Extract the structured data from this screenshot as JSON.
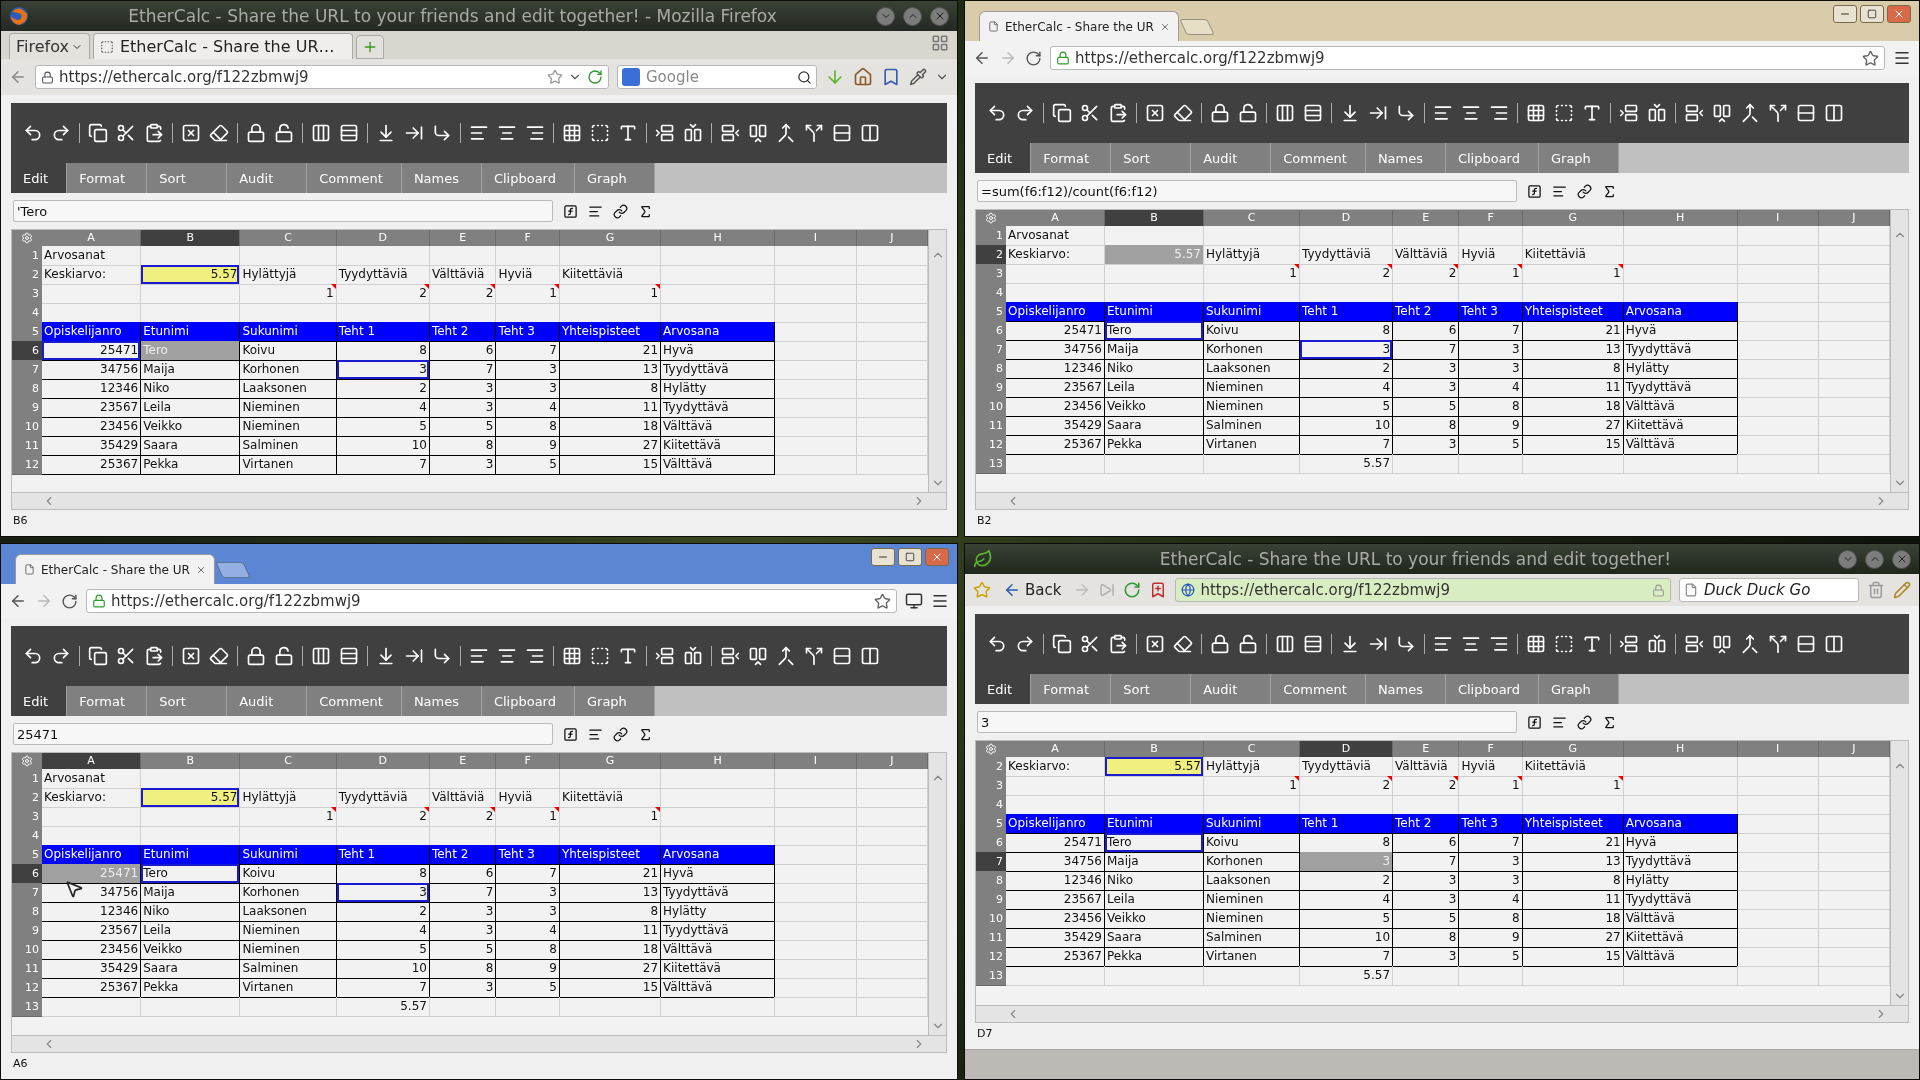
{
  "windows": [
    {
      "kind": "firefox",
      "color": "#232823",
      "title": "EtherCalc - Share the URL to your friends and edit together! - Mozilla Firefox",
      "menu_button": "Firefox",
      "tab_title": "EtherCalc - Share the UR…",
      "url": "https://ethercalc.org/f122zbmwj9",
      "search_placeholder": "Google",
      "app": {
        "tabs": [
          {
            "label": "Edit",
            "selected": true
          },
          {
            "label": "Format",
            "selected": false
          },
          {
            "label": "Sort",
            "selected": false
          },
          {
            "label": "Audit",
            "selected": false
          },
          {
            "label": "Comment",
            "selected": false
          },
          {
            "label": "Names",
            "selected": false
          },
          {
            "label": "Clipboard",
            "selected": false
          },
          {
            "label": "Graph",
            "selected": false
          }
        ],
        "formula": "'Tero",
        "columns": [
          {
            "label": "A",
            "selected": false,
            "kind": "number"
          },
          {
            "label": "B",
            "selected": true,
            "kind": "text"
          },
          {
            "label": "C",
            "selected": false,
            "kind": "text"
          },
          {
            "label": "D",
            "selected": false,
            "kind": "number"
          },
          {
            "label": "E",
            "selected": false,
            "kind": "number"
          },
          {
            "label": "F",
            "selected": false,
            "kind": "number"
          },
          {
            "label": "G",
            "selected": false,
            "kind": "number"
          },
          {
            "label": "H",
            "selected": false,
            "kind": "text"
          },
          {
            "label": "I",
            "selected": false,
            "kind": "blank"
          },
          {
            "label": "J",
            "selected": false,
            "kind": "blank"
          }
        ],
        "rows": [
          {
            "number": "1",
            "selected": false,
            "kind": "labels",
            "cells": [
              "Arvosanat"
            ]
          },
          {
            "number": "2",
            "selected": false,
            "kind": "labels",
            "cells": [
              "Keskiarvo:",
              {
                "text": "5.57",
                "kind": "right",
                "selected": false,
                "peer": true,
                "highlighted": true
              },
              "Hylättyjä",
              "Tyydyttäviä",
              "Välttäviä",
              "Hyviä",
              "Kiitettäviä"
            ]
          },
          {
            "number": "3",
            "selected": false,
            "kind": "counts",
            "cells": [
              null,
              null,
              {
                "text": "1",
                "comment": true
              },
              {
                "text": "2",
                "comment": true
              },
              {
                "text": "2",
                "comment": true
              },
              {
                "text": "1",
                "comment": true
              },
              {
                "text": "1",
                "comment": true
              }
            ]
          },
          {
            "number": "4",
            "selected": false,
            "kind": "blank"
          },
          {
            "number": "5",
            "selected": false,
            "kind": "header",
            "cells": [
              "Opiskelijanro",
              "Etunimi",
              "Sukunimi",
              "Teht 1",
              "Teht 2",
              "Teht 3",
              "Yhteispisteet",
              "Arvosana"
            ]
          },
          {
            "number": "6",
            "selected": true,
            "kind": "record",
            "cells": [
              {
                "text": "25471",
                "selected": false,
                "peer": true
              },
              {
                "text": "Tero",
                "selected": true,
                "peer": false
              },
              "Koivu",
              "8",
              "6",
              "7",
              "21",
              "Hyvä"
            ]
          },
          {
            "number": "7",
            "selected": false,
            "kind": "record",
            "cells": [
              "34756",
              "Maija",
              "Korhonen",
              {
                "text": "3",
                "selected": false,
                "peer": true
              },
              "7",
              "3",
              "13",
              "Tyydyttävä"
            ]
          },
          {
            "number": "8",
            "selected": false,
            "kind": "record",
            "cells": [
              "12346",
              "Niko",
              "Laaksonen",
              "2",
              "3",
              "3",
              "8",
              "Hylätty"
            ]
          },
          {
            "number": "9",
            "selected": false,
            "kind": "record",
            "cells": [
              "23567",
              "Leila",
              "Nieminen",
              "4",
              "3",
              "4",
              "11",
              "Tyydyttävä"
            ]
          },
          {
            "number": "10",
            "selected": false,
            "kind": "record",
            "cells": [
              "23456",
              "Veikko",
              "Nieminen",
              "5",
              "5",
              "8",
              "18",
              "Välttävä"
            ]
          },
          {
            "number": "11",
            "selected": false,
            "kind": "record",
            "cells": [
              "35429",
              "Saara",
              "Salminen",
              "10",
              "8",
              "9",
              "27",
              "Kiitettävä"
            ]
          },
          {
            "number": "12",
            "selected": false,
            "kind": "record",
            "cells": [
              "25367",
              "Pekka",
              "Virtanen",
              "7",
              "3",
              "5",
              "15",
              "Välttävä"
            ]
          }
        ],
        "status": "B6"
      }
    },
    {
      "kind": "chrome",
      "color": "#d9ccaa",
      "tab_title": "EtherCalc - Share the UR",
      "url": "https://ethercalc.org/f122zbmwj9",
      "cast_button": false,
      "app": {
        "tabs": [
          {
            "label": "Edit",
            "selected": true
          },
          {
            "label": "Format",
            "selected": false
          },
          {
            "label": "Sort",
            "selected": false
          },
          {
            "label": "Audit",
            "selected": false
          },
          {
            "label": "Comment",
            "selected": false
          },
          {
            "label": "Names",
            "selected": false
          },
          {
            "label": "Clipboard",
            "selected": false
          },
          {
            "label": "Graph",
            "selected": false
          }
        ],
        "formula": "=sum(f6:f12)/count(f6:f12)",
        "columns": [
          {
            "label": "A",
            "selected": false,
            "kind": "number"
          },
          {
            "label": "B",
            "selected": true,
            "kind": "text"
          },
          {
            "label": "C",
            "selected": false,
            "kind": "text"
          },
          {
            "label": "D",
            "selected": false,
            "kind": "number"
          },
          {
            "label": "E",
            "selected": false,
            "kind": "number"
          },
          {
            "label": "F",
            "selected": false,
            "kind": "number"
          },
          {
            "label": "G",
            "selected": false,
            "kind": "number"
          },
          {
            "label": "H",
            "selected": false,
            "kind": "text"
          },
          {
            "label": "I",
            "selected": false,
            "kind": "blank"
          },
          {
            "label": "J",
            "selected": false,
            "kind": "blank"
          }
        ],
        "rows": [
          {
            "number": "1",
            "selected": false,
            "kind": "labels",
            "cells": [
              "Arvosanat"
            ]
          },
          {
            "number": "2",
            "selected": true,
            "kind": "labels",
            "cells": [
              "Keskiarvo:",
              {
                "text": "5.57",
                "kind": "right",
                "selected": true,
                "peer": false
              },
              "Hylättyjä",
              "Tyydyttäviä",
              "Välttäviä",
              "Hyviä",
              "Kiitettäviä"
            ]
          },
          {
            "number": "3",
            "selected": false,
            "kind": "counts",
            "cells": [
              null,
              null,
              {
                "text": "1",
                "comment": true
              },
              {
                "text": "2",
                "comment": true
              },
              {
                "text": "2",
                "comment": true
              },
              {
                "text": "1",
                "comment": true
              },
              {
                "text": "1",
                "comment": true
              }
            ]
          },
          {
            "number": "4",
            "selected": false,
            "kind": "blank"
          },
          {
            "number": "5",
            "selected": false,
            "kind": "header",
            "cells": [
              "Opiskelijanro",
              "Etunimi",
              "Sukunimi",
              "Teht 1",
              "Teht 2",
              "Teht 3",
              "Yhteispisteet",
              "Arvosana"
            ]
          },
          {
            "number": "6",
            "selected": false,
            "kind": "record",
            "cells": [
              "25471",
              {
                "text": "Tero",
                "selected": false,
                "peer": true
              },
              "Koivu",
              "8",
              "6",
              "7",
              "21",
              "Hyvä"
            ]
          },
          {
            "number": "7",
            "selected": false,
            "kind": "record",
            "cells": [
              "34756",
              "Maija",
              "Korhonen",
              {
                "text": "3",
                "selected": false,
                "peer": true
              },
              "7",
              "3",
              "13",
              "Tyydyttävä"
            ]
          },
          {
            "number": "8",
            "selected": false,
            "kind": "record",
            "cells": [
              "12346",
              "Niko",
              "Laaksonen",
              "2",
              "3",
              "3",
              "8",
              "Hylätty"
            ]
          },
          {
            "number": "9",
            "selected": false,
            "kind": "record",
            "cells": [
              "23567",
              "Leila",
              "Nieminen",
              "4",
              "3",
              "4",
              "11",
              "Tyydyttävä"
            ]
          },
          {
            "number": "10",
            "selected": false,
            "kind": "record",
            "cells": [
              "23456",
              "Veikko",
              "Nieminen",
              "5",
              "5",
              "8",
              "18",
              "Välttävä"
            ]
          },
          {
            "number": "11",
            "selected": false,
            "kind": "record",
            "cells": [
              "35429",
              "Saara",
              "Salminen",
              "10",
              "8",
              "9",
              "27",
              "Kiitettävä"
            ]
          },
          {
            "number": "12",
            "selected": false,
            "kind": "record",
            "cells": [
              "25367",
              "Pekka",
              "Virtanen",
              "7",
              "3",
              "5",
              "15",
              "Välttävä"
            ]
          },
          {
            "number": "13",
            "selected": false,
            "kind": "total",
            "cells": [
              null,
              null,
              null,
              "5.57"
            ]
          }
        ],
        "status": "B2"
      }
    },
    {
      "kind": "chrome",
      "color": "#5b86d4",
      "tab_title": "EtherCalc - Share the UR",
      "url": "https://ethercalc.org/f122zbmwj9",
      "cast_button": true,
      "mouse_pointer": true,
      "app": {
        "tabs": [
          {
            "label": "Edit",
            "selected": true
          },
          {
            "label": "Format",
            "selected": false
          },
          {
            "label": "Sort",
            "selected": false
          },
          {
            "label": "Audit",
            "selected": false
          },
          {
            "label": "Comment",
            "selected": false
          },
          {
            "label": "Names",
            "selected": false
          },
          {
            "label": "Clipboard",
            "selected": false
          },
          {
            "label": "Graph",
            "selected": false
          }
        ],
        "formula": "25471",
        "columns": [
          {
            "label": "A",
            "selected": true,
            "kind": "number"
          },
          {
            "label": "B",
            "selected": false,
            "kind": "text"
          },
          {
            "label": "C",
            "selected": false,
            "kind": "text"
          },
          {
            "label": "D",
            "selected": false,
            "kind": "number"
          },
          {
            "label": "E",
            "selected": false,
            "kind": "number"
          },
          {
            "label": "F",
            "selected": false,
            "kind": "number"
          },
          {
            "label": "G",
            "selected": false,
            "kind": "number"
          },
          {
            "label": "H",
            "selected": false,
            "kind": "text"
          },
          {
            "label": "I",
            "selected": false,
            "kind": "blank"
          },
          {
            "label": "J",
            "selected": false,
            "kind": "blank"
          }
        ],
        "rows": [
          {
            "number": "1",
            "selected": false,
            "kind": "labels",
            "cells": [
              "Arvosanat"
            ]
          },
          {
            "number": "2",
            "selected": false,
            "kind": "labels",
            "cells": [
              "Keskiarvo:",
              {
                "text": "5.57",
                "kind": "right",
                "selected": false,
                "peer": true,
                "highlighted": true
              },
              "Hylättyjä",
              "Tyydyttäviä",
              "Välttäviä",
              "Hyviä",
              "Kiitettäviä"
            ]
          },
          {
            "number": "3",
            "selected": false,
            "kind": "counts",
            "cells": [
              null,
              null,
              {
                "text": "1",
                "comment": true
              },
              {
                "text": "2",
                "comment": true
              },
              {
                "text": "2",
                "comment": true
              },
              {
                "text": "1",
                "comment": true
              },
              {
                "text": "1",
                "comment": true
              }
            ]
          },
          {
            "number": "4",
            "selected": false,
            "kind": "blank"
          },
          {
            "number": "5",
            "selected": false,
            "kind": "header",
            "cells": [
              "Opiskelijanro",
              "Etunimi",
              "Sukunimi",
              "Teht 1",
              "Teht 2",
              "Teht 3",
              "Yhteispisteet",
              "Arvosana"
            ]
          },
          {
            "number": "6",
            "selected": true,
            "kind": "record",
            "cells": [
              {
                "text": "25471",
                "selected": true,
                "peer": false
              },
              {
                "text": "Tero",
                "selected": false,
                "peer": true
              },
              "Koivu",
              "8",
              "6",
              "7",
              "21",
              "Hyvä"
            ]
          },
          {
            "number": "7",
            "selected": false,
            "kind": "record",
            "cells": [
              "34756",
              "Maija",
              "Korhonen",
              {
                "text": "3",
                "selected": false,
                "peer": true
              },
              "7",
              "3",
              "13",
              "Tyydyttävä"
            ]
          },
          {
            "number": "8",
            "selected": false,
            "kind": "record",
            "cells": [
              "12346",
              "Niko",
              "Laaksonen",
              "2",
              "3",
              "3",
              "8",
              "Hylätty"
            ]
          },
          {
            "number": "9",
            "selected": false,
            "kind": "record",
            "cells": [
              "23567",
              "Leila",
              "Nieminen",
              "4",
              "3",
              "4",
              "11",
              "Tyydyttävä"
            ]
          },
          {
            "number": "10",
            "selected": false,
            "kind": "record",
            "cells": [
              "23456",
              "Veikko",
              "Nieminen",
              "5",
              "5",
              "8",
              "18",
              "Välttävä"
            ]
          },
          {
            "number": "11",
            "selected": false,
            "kind": "record",
            "cells": [
              "35429",
              "Saara",
              "Salminen",
              "10",
              "8",
              "9",
              "27",
              "Kiitettävä"
            ]
          },
          {
            "number": "12",
            "selected": false,
            "kind": "record",
            "cells": [
              "25367",
              "Pekka",
              "Virtanen",
              "7",
              "3",
              "5",
              "15",
              "Välttävä"
            ]
          },
          {
            "number": "13",
            "selected": false,
            "kind": "total",
            "cells": [
              null,
              null,
              null,
              "5.57"
            ]
          }
        ],
        "status": "A6"
      }
    },
    {
      "kind": "other",
      "color": "#1f261c",
      "title": "EtherCalc - Share the URL to your friends and edit together!",
      "back_button": "Back",
      "url": "https://ethercalc.org/f122zbmwj9",
      "search_placeholder": "Duck Duck Go",
      "app": {
        "tabs": [
          {
            "label": "Edit",
            "selected": true
          },
          {
            "label": "Format",
            "selected": false
          },
          {
            "label": "Sort",
            "selected": false
          },
          {
            "label": "Audit",
            "selected": false
          },
          {
            "label": "Comment",
            "selected": false
          },
          {
            "label": "Names",
            "selected": false
          },
          {
            "label": "Clipboard",
            "selected": false
          },
          {
            "label": "Graph",
            "selected": false
          }
        ],
        "formula": "3",
        "columns": [
          {
            "label": "A",
            "selected": false,
            "kind": "number"
          },
          {
            "label": "B",
            "selected": false,
            "kind": "text"
          },
          {
            "label": "C",
            "selected": false,
            "kind": "text"
          },
          {
            "label": "D",
            "selected": true,
            "kind": "number"
          },
          {
            "label": "E",
            "selected": false,
            "kind": "number"
          },
          {
            "label": "F",
            "selected": false,
            "kind": "number"
          },
          {
            "label": "G",
            "selected": false,
            "kind": "number"
          },
          {
            "label": "H",
            "selected": false,
            "kind": "text"
          },
          {
            "label": "I",
            "selected": false,
            "kind": "blank"
          },
          {
            "label": "J",
            "selected": false,
            "kind": "blank"
          }
        ],
        "rows": [
          {
            "number": "2",
            "selected": false,
            "kind": "labels",
            "cells": [
              "Keskiarvo:",
              {
                "text": "5.57",
                "kind": "right",
                "selected": false,
                "peer": true,
                "highlighted": true
              },
              "Hylättyjä",
              "Tyydyttäviä",
              "Välttäviä",
              "Hyviä",
              "Kiitettäviä"
            ]
          },
          {
            "number": "3",
            "selected": false,
            "kind": "counts",
            "cells": [
              null,
              null,
              {
                "text": "1",
                "comment": true
              },
              {
                "text": "2",
                "comment": true
              },
              {
                "text": "2",
                "comment": true
              },
              {
                "text": "1",
                "comment": true
              },
              {
                "text": "1",
                "comment": true
              }
            ]
          },
          {
            "number": "4",
            "selected": false,
            "kind": "blank"
          },
          {
            "number": "5",
            "selected": false,
            "kind": "header",
            "cells": [
              "Opiskelijanro",
              "Etunimi",
              "Sukunimi",
              "Teht 1",
              "Teht 2",
              "Teht 3",
              "Yhteispisteet",
              "Arvosana"
            ]
          },
          {
            "number": "6",
            "selected": false,
            "kind": "record",
            "cells": [
              "25471",
              {
                "text": "Tero",
                "selected": false,
                "peer": true
              },
              "Koivu",
              "8",
              "6",
              "7",
              "21",
              "Hyvä"
            ]
          },
          {
            "number": "7",
            "selected": true,
            "kind": "record",
            "cells": [
              "34756",
              "Maija",
              "Korhonen",
              {
                "text": "3",
                "selected": true,
                "peer": false
              },
              "7",
              "3",
              "13",
              "Tyydyttävä"
            ]
          },
          {
            "number": "8",
            "selected": false,
            "kind": "record",
            "cells": [
              "12346",
              "Niko",
              "Laaksonen",
              "2",
              "3",
              "3",
              "8",
              "Hylätty"
            ]
          },
          {
            "number": "9",
            "selected": false,
            "kind": "record",
            "cells": [
              "23567",
              "Leila",
              "Nieminen",
              "4",
              "3",
              "4",
              "11",
              "Tyydyttävä"
            ]
          },
          {
            "number": "10",
            "selected": false,
            "kind": "record",
            "cells": [
              "23456",
              "Veikko",
              "Nieminen",
              "5",
              "5",
              "8",
              "18",
              "Välttävä"
            ]
          },
          {
            "number": "11",
            "selected": false,
            "kind": "record",
            "cells": [
              "35429",
              "Saara",
              "Salminen",
              "10",
              "8",
              "9",
              "27",
              "Kiitettävä"
            ]
          },
          {
            "number": "12",
            "selected": false,
            "kind": "record",
            "cells": [
              "25367",
              "Pekka",
              "Virtanen",
              "7",
              "3",
              "5",
              "15",
              "Välttävä"
            ]
          },
          {
            "number": "13",
            "selected": false,
            "kind": "total",
            "cells": [
              null,
              null,
              null,
              "5.57"
            ]
          }
        ],
        "status": "D7"
      }
    }
  ]
}
